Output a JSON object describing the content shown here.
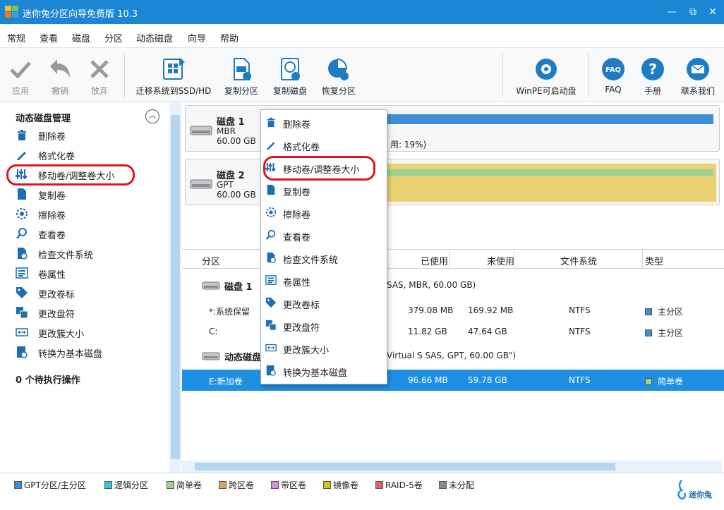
{
  "app": {
    "title": "迷你兔分区向导免费版 10.3"
  },
  "window_controls": {
    "minimize": "—",
    "maximize": "⧉",
    "close": "✕"
  },
  "menu": [
    "常规",
    "查看",
    "磁盘",
    "分区",
    "动态磁盘",
    "向导",
    "帮助"
  ],
  "toolbar": {
    "apply": "应用",
    "undo": "撤销",
    "discard": "放弃",
    "migrate": "迁移系统到SSD/HD",
    "copy_partition": "复制分区",
    "copy_disk": "复制磁盘",
    "recover_partition": "恢复分区",
    "winpe": "WinPE可启动盘",
    "faq": "FAQ",
    "manual": "手册",
    "contact": "联系我们"
  },
  "left_panel": {
    "heading": "动态磁盘管理",
    "items": [
      "删除卷",
      "格式化卷",
      "移动卷/调整卷大小",
      "复制卷",
      "擦除卷",
      "查看卷",
      "检查文件系统",
      "卷属性",
      "更改卷标",
      "更改盘符",
      "更改簇大小",
      "转换为基本磁盘"
    ],
    "pending": "0 个待执行操作"
  },
  "disks": [
    {
      "name": "磁盘 1",
      "type": "MBR",
      "size": "60.00 GB",
      "usage_text": "用: 19%)"
    },
    {
      "name": "磁盘 2",
      "type": "GPT",
      "size": "60.00 GB"
    }
  ],
  "table": {
    "headers": [
      "分区",
      "已使用",
      "未使用",
      "文件系统",
      "类型"
    ],
    "group1": {
      "label": "磁盘 1",
      "detail": "SAS, MBR, 60.00 GB)"
    },
    "group2": {
      "label": "动态磁盘",
      "detail": "Virtual S SAS, GPT, 60.00 GB\")"
    },
    "rows": [
      {
        "partition": "*:系统保留",
        "used": "379.08 MB",
        "unused": "169.92 MB",
        "fs": "NTFS",
        "type": "主分区"
      },
      {
        "partition": "C:",
        "used": "11.82 GB",
        "unused": "47.64 GB",
        "fs": "NTFS",
        "type": "主分区"
      },
      {
        "partition": "E:新加卷",
        "used": "96.66 MB",
        "unused": "59.78 GB",
        "fs": "NTFS",
        "type": "简单卷"
      }
    ]
  },
  "context_menu": [
    "删除卷",
    "格式化卷",
    "移动卷/调整卷大小",
    "复制卷",
    "擦除卷",
    "查看卷",
    "检查文件系统",
    "卷属性",
    "更改卷标",
    "更改盘符",
    "更改簇大小",
    "转换为基本磁盘"
  ],
  "legend": [
    {
      "label": "GPT分区/主分区",
      "color": "#3f8fd6"
    },
    {
      "label": "逻辑分区",
      "color": "#35c3e0"
    },
    {
      "label": "简单卷",
      "color": "#9ed38f"
    },
    {
      "label": "跨区卷",
      "color": "#d9a45a"
    },
    {
      "label": "带区卷",
      "color": "#d48fe0"
    },
    {
      "label": "镜像卷",
      "color": "#d4c51e"
    },
    {
      "label": "RAID-5卷",
      "color": "#ee5d5d"
    },
    {
      "label": "未分配",
      "color": "#8a8a8a"
    }
  ],
  "brand": {
    "text": "迷你兔"
  },
  "colors": {
    "titlebar": "#1b86d3",
    "selection": "#1e8fe2",
    "highlight": "#e0141e",
    "disk2_bar": "#ead273"
  }
}
